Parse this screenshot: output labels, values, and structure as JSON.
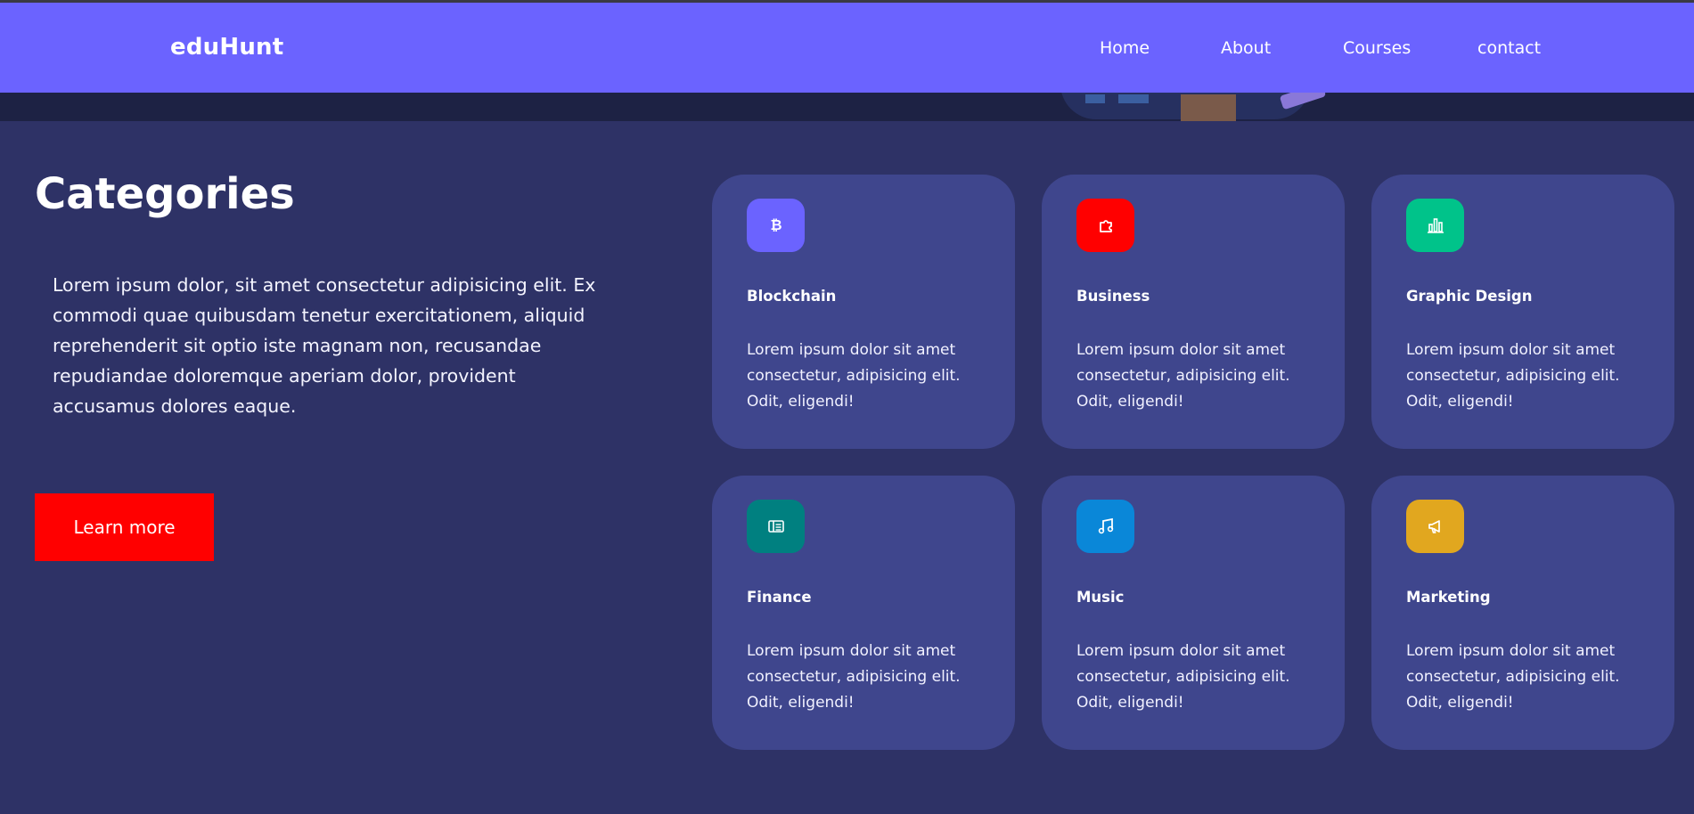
{
  "header": {
    "brand": "eduHunt",
    "nav": [
      "Home",
      "About",
      "Courses",
      "contact"
    ]
  },
  "categories": {
    "title": "Categories",
    "description": "Lorem ipsum dolor, sit amet consectetur adipisicing elit. Ex commodi quae quibusdam tenetur exercitationem, aliquid reprehenderit sit optio iste magnam non, recusandae repudiandae doloremque aperiam dolor, provident accusamus dolores eaque.",
    "button": "Learn more",
    "cards": [
      {
        "title": "Blockchain",
        "text": "Lorem ipsum dolor sit amet consectetur, adipisicing elit. Odit, eligendi!",
        "icon": "bitcoin-icon",
        "color": "#6b63ff"
      },
      {
        "title": "Business",
        "text": "Lorem ipsum dolor sit amet consectetur, adipisicing elit. Odit, eligendi!",
        "icon": "puzzle-icon",
        "color": "#ff0000"
      },
      {
        "title": "Graphic Design",
        "text": "Lorem ipsum dolor sit amet consectetur, adipisicing elit. Odit, eligendi!",
        "icon": "bar-chart-icon",
        "color": "#00c38a"
      },
      {
        "title": "Finance",
        "text": "Lorem ipsum dolor sit amet consectetur, adipisicing elit. Odit, eligendi!",
        "icon": "ledger-icon",
        "color": "#008080"
      },
      {
        "title": "Music",
        "text": "Lorem ipsum dolor sit amet consectetur, adipisicing elit. Odit, eligendi!",
        "icon": "music-icon",
        "color": "#0a87d8"
      },
      {
        "title": "Marketing",
        "text": "Lorem ipsum dolor sit amet consectetur, adipisicing elit. Odit, eligendi!",
        "icon": "megaphone-icon",
        "color": "#e1a71f"
      }
    ]
  },
  "colors": {
    "navbar": "#6b63ff",
    "background": "#2e3266",
    "card": "#3f468d",
    "button": "#ff0000"
  }
}
